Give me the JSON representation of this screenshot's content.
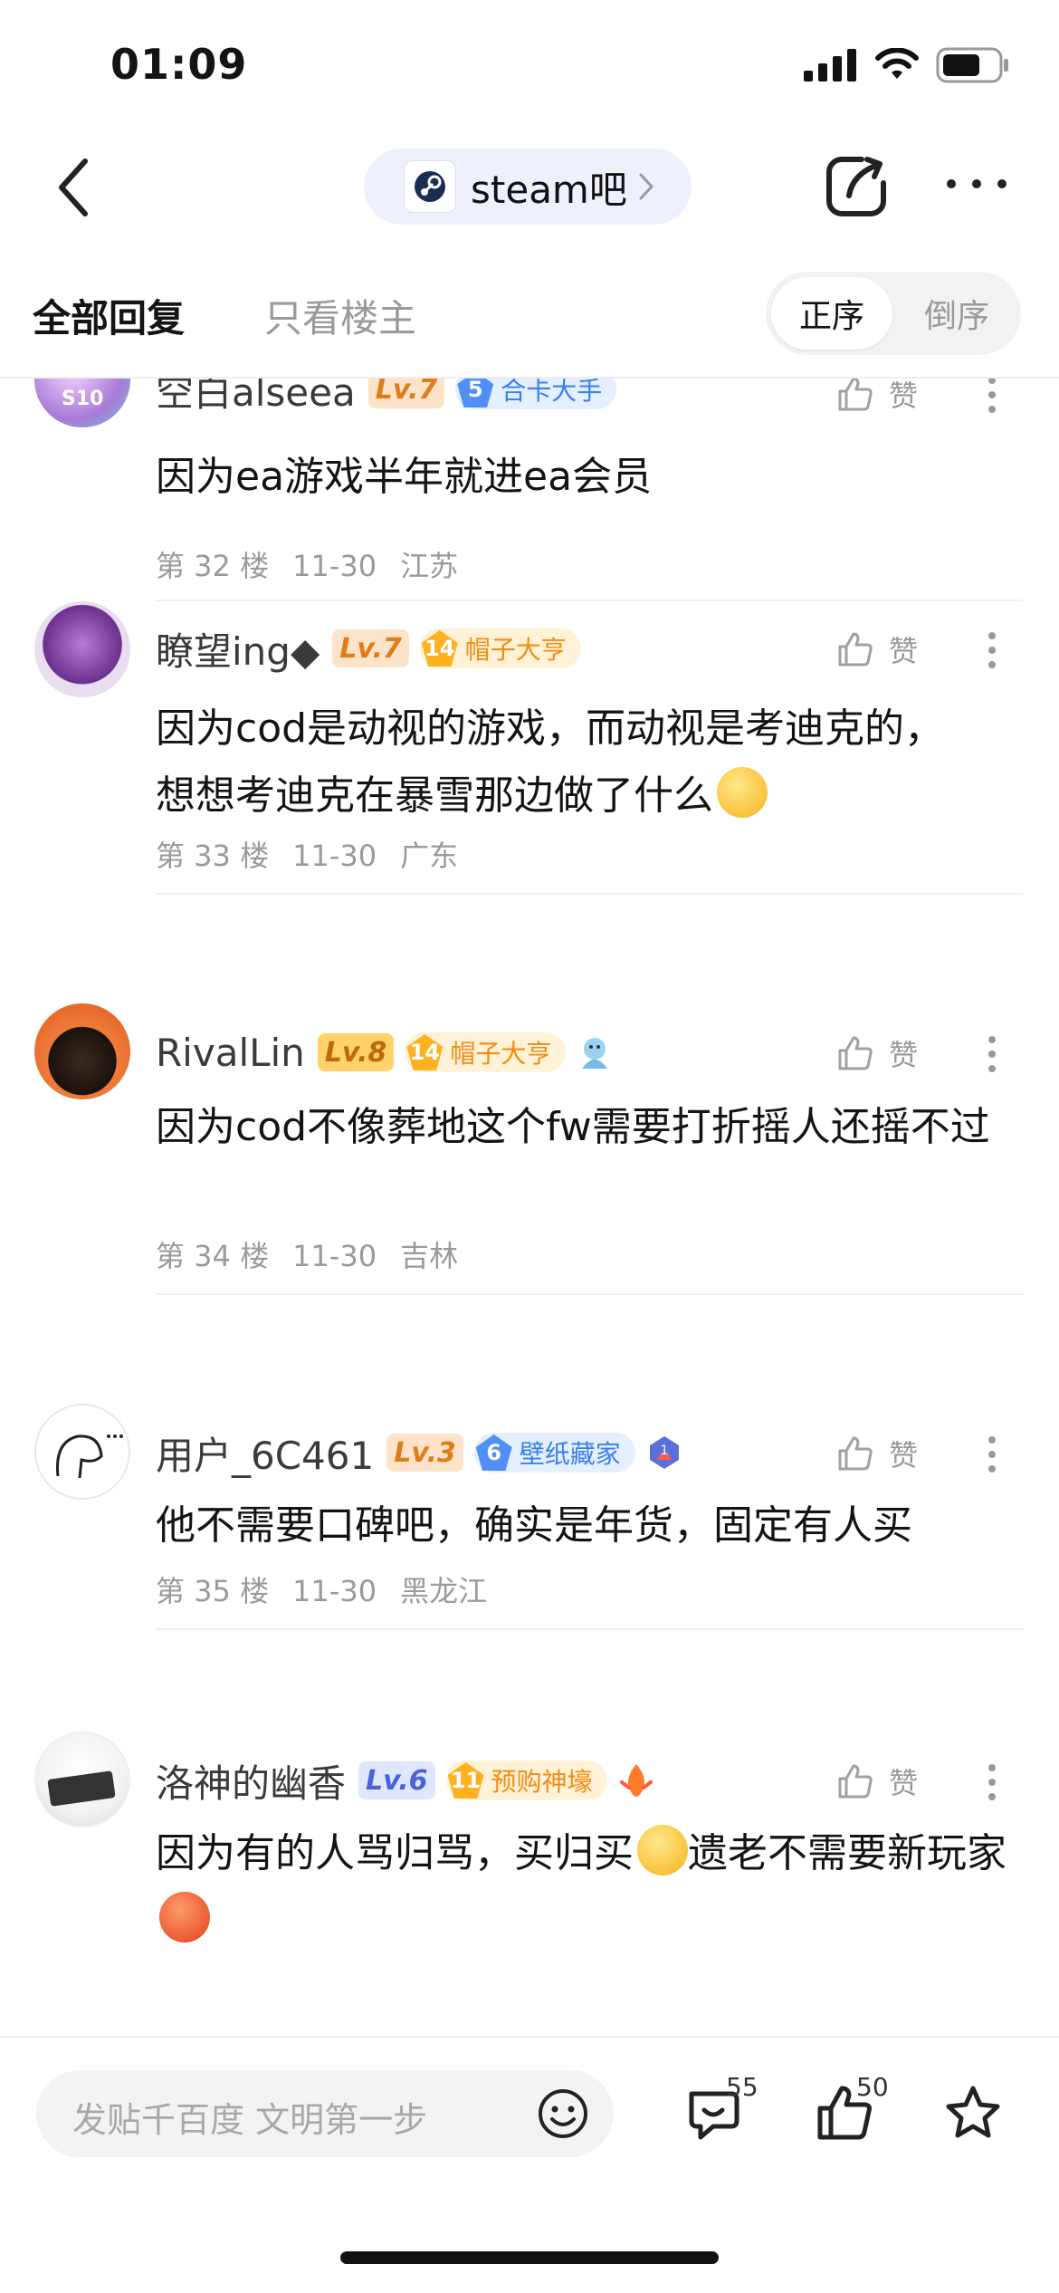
{
  "status_bar": {
    "time": "01:09"
  },
  "nav": {
    "forum_name": "steam吧"
  },
  "tabs": {
    "all": "全部回复",
    "op_only": "只看楼主",
    "sort_asc": "正序",
    "sort_desc": "倒序"
  },
  "posts": [
    {
      "username": "空白alseea",
      "level": "Lv.7",
      "honor_num": "5",
      "honor_text": "合卡大手",
      "content": "因为ea游戏半年就进ea会员",
      "floor": "第 32 楼",
      "date": "11-30",
      "location": "江苏",
      "like_label": "赞"
    },
    {
      "username": "瞭望ing◆",
      "level": "Lv.7",
      "honor_num": "14",
      "honor_text": "帽子大亨",
      "content": "因为cod是动视的游戏，而动视是考迪克的，想想考迪克在暴雪那边做了什么",
      "floor": "第 33 楼",
      "date": "11-30",
      "location": "广东",
      "like_label": "赞"
    },
    {
      "username": "RivalLin",
      "level": "Lv.8",
      "honor_num": "14",
      "honor_text": "帽子大亨",
      "content": "因为cod不像葬地这个fw需要打折摇人还摇不过",
      "floor": "第 34 楼",
      "date": "11-30",
      "location": "吉林",
      "like_label": "赞"
    },
    {
      "username": "用户_6C461",
      "level": "Lv.3",
      "honor_num": "6",
      "honor_text": "壁纸藏家",
      "content": "他不需要口碑吧，确实是年货，固定有人买",
      "floor": "第 35 楼",
      "date": "11-30",
      "location": "黑龙江",
      "like_label": "赞"
    },
    {
      "username": "洛神的幽香",
      "level": "Lv.6",
      "honor_num": "11",
      "honor_text": "预购神壕",
      "content_a": "因为有的人骂归骂，买归买",
      "content_b": "遗老不需要新玩家",
      "like_label": "赞"
    }
  ],
  "bottom_bar": {
    "reply_placeholder": "发贴千百度 文明第一步",
    "comment_count": "55",
    "like_count": "50"
  }
}
